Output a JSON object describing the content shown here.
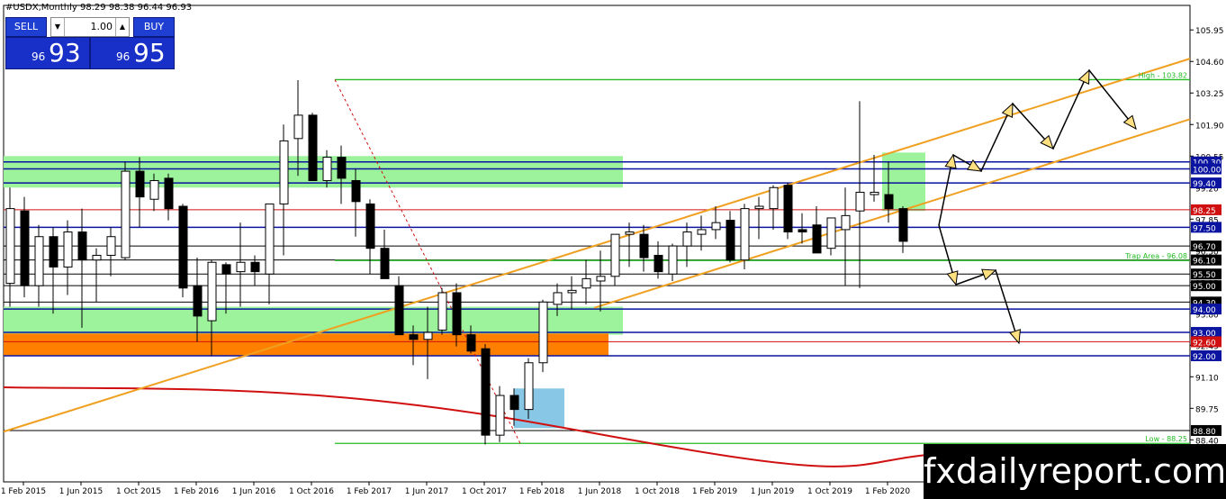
{
  "header": {
    "symbol": "#USDX,Monthly",
    "ohlc": "98.29 98.38 96.44 96.93"
  },
  "trade_panel": {
    "sell_label": "SELL",
    "buy_label": "BUY",
    "lot": "1.00",
    "sell_small": "96",
    "sell_big": "93",
    "buy_small": "96",
    "buy_big": "95"
  },
  "watermark": "fxdailyreport.com",
  "chart_data": {
    "type": "candlestick",
    "x_ticks": [
      "1 Feb 2015",
      "1 Jun 2015",
      "1 Oct 2015",
      "1 Feb 2016",
      "1 Jun 2016",
      "1 Oct 2016",
      "1 Feb 2017",
      "1 Jun 2017",
      "1 Oct 2017",
      "1 Feb 2018",
      "1 Jun 2018",
      "1 Oct 2018",
      "1 Feb 2019",
      "1 Jun 2019",
      "1 Oct 2019",
      "1 Feb 2020"
    ],
    "y_ticks": [
      "105.95",
      "104.60",
      "103.25",
      "101.90",
      "100.55",
      "99.20",
      "97.85",
      "96.50",
      "95.15",
      "93.80",
      "92.45",
      "91.10",
      "89.75",
      "88.40",
      "87.05"
    ],
    "y_range": [
      86.6,
      107.0
    ],
    "levels": [
      {
        "label": "100.30",
        "price": 100.3,
        "color": "#0a14a0"
      },
      {
        "label": "100.00",
        "price": 100.0,
        "color": "#0a14a0"
      },
      {
        "label": "99.40",
        "price": 99.4,
        "color": "#0a14a0"
      },
      {
        "label": "98.25",
        "price": 98.25,
        "color": "#d01010"
      },
      {
        "label": "97.50",
        "price": 97.5,
        "color": "#0a14a0"
      },
      {
        "label": "96.70",
        "price": 96.7,
        "color": "#000000"
      },
      {
        "label": "96.10",
        "price": 96.1,
        "color": "#000000"
      },
      {
        "label": "95.50",
        "price": 95.5,
        "color": "#000000"
      },
      {
        "label": "95.00",
        "price": 95.0,
        "color": "#000000"
      },
      {
        "label": "94.30",
        "price": 94.3,
        "color": "#000000"
      },
      {
        "label": "94.00",
        "price": 94.0,
        "color": "#0a14a0"
      },
      {
        "label": "93.00",
        "price": 93.0,
        "color": "#0a14a0"
      },
      {
        "label": "92.60",
        "price": 92.6,
        "color": "#d01010"
      },
      {
        "label": "92.00",
        "price": 92.0,
        "color": "#0a14a0"
      },
      {
        "label": "88.80",
        "price": 88.8,
        "color": "#000000"
      }
    ],
    "annotations": [
      {
        "label": "High - 103.82",
        "price": 103.82
      },
      {
        "label": "Trap Area - 96.08",
        "price": 96.08
      },
      {
        "label": "Low - 88.25",
        "price": 88.25
      }
    ],
    "candles": [
      {
        "o": 95.1,
        "h": 99.2,
        "l": 94.1,
        "c": 98.3
      },
      {
        "o": 98.2,
        "h": 98.8,
        "l": 94.5,
        "c": 95.0
      },
      {
        "o": 95.0,
        "h": 97.6,
        "l": 94.1,
        "c": 97.1
      },
      {
        "o": 97.1,
        "h": 97.5,
        "l": 93.8,
        "c": 95.8
      },
      {
        "o": 95.8,
        "h": 97.8,
        "l": 94.6,
        "c": 97.3
      },
      {
        "o": 97.3,
        "h": 98.3,
        "l": 93.2,
        "c": 96.1
      },
      {
        "o": 96.1,
        "h": 96.6,
        "l": 94.3,
        "c": 96.3
      },
      {
        "o": 96.3,
        "h": 97.5,
        "l": 95.4,
        "c": 97.1
      },
      {
        "o": 96.2,
        "h": 100.3,
        "l": 96.1,
        "c": 99.9
      },
      {
        "o": 99.9,
        "h": 100.5,
        "l": 97.5,
        "c": 98.8
      },
      {
        "o": 98.7,
        "h": 99.8,
        "l": 98.2,
        "c": 99.5
      },
      {
        "o": 99.6,
        "h": 99.8,
        "l": 97.8,
        "c": 98.3
      },
      {
        "o": 98.4,
        "h": 98.5,
        "l": 94.5,
        "c": 94.9
      },
      {
        "o": 95.0,
        "h": 96.2,
        "l": 92.6,
        "c": 93.7
      },
      {
        "o": 93.5,
        "h": 96.1,
        "l": 92.0,
        "c": 96.0
      },
      {
        "o": 95.9,
        "h": 96.0,
        "l": 93.8,
        "c": 95.5
      },
      {
        "o": 95.6,
        "h": 97.7,
        "l": 94.1,
        "c": 96.0
      },
      {
        "o": 96.0,
        "h": 96.3,
        "l": 95.0,
        "c": 95.6
      },
      {
        "o": 95.5,
        "h": 98.3,
        "l": 94.2,
        "c": 98.5
      },
      {
        "o": 98.5,
        "h": 101.9,
        "l": 96.3,
        "c": 101.2
      },
      {
        "o": 101.3,
        "h": 103.8,
        "l": 99.7,
        "c": 102.3
      },
      {
        "o": 102.3,
        "h": 102.4,
        "l": 99.5,
        "c": 99.5
      },
      {
        "o": 99.5,
        "h": 100.8,
        "l": 99.2,
        "c": 100.5
      },
      {
        "o": 100.5,
        "h": 101.0,
        "l": 98.5,
        "c": 99.6
      },
      {
        "o": 99.5,
        "h": 100.0,
        "l": 97.1,
        "c": 98.6
      },
      {
        "o": 98.5,
        "h": 98.7,
        "l": 95.5,
        "c": 96.6
      },
      {
        "o": 96.6,
        "h": 97.4,
        "l": 95.9,
        "c": 95.3
      },
      {
        "o": 95.0,
        "h": 95.4,
        "l": 93.2,
        "c": 92.9
      },
      {
        "o": 92.9,
        "h": 93.3,
        "l": 91.6,
        "c": 92.7
      },
      {
        "o": 92.7,
        "h": 94.1,
        "l": 91.0,
        "c": 93.0
      },
      {
        "o": 93.1,
        "h": 94.9,
        "l": 92.9,
        "c": 94.7
      },
      {
        "o": 94.7,
        "h": 95.1,
        "l": 92.4,
        "c": 92.9
      },
      {
        "o": 92.9,
        "h": 93.3,
        "l": 92.1,
        "c": 92.2
      },
      {
        "o": 92.3,
        "h": 92.5,
        "l": 88.2,
        "c": 88.6
      },
      {
        "o": 88.6,
        "h": 90.7,
        "l": 88.3,
        "c": 90.3
      },
      {
        "o": 90.3,
        "h": 90.6,
        "l": 89.0,
        "c": 89.7
      },
      {
        "o": 89.7,
        "h": 91.9,
        "l": 89.3,
        "c": 91.7
      },
      {
        "o": 91.7,
        "h": 94.4,
        "l": 91.3,
        "c": 94.3
      },
      {
        "o": 94.2,
        "h": 95.1,
        "l": 93.7,
        "c": 94.7
      },
      {
        "o": 94.7,
        "h": 95.4,
        "l": 94.0,
        "c": 94.8
      },
      {
        "o": 94.9,
        "h": 96.1,
        "l": 94.2,
        "c": 95.3
      },
      {
        "o": 95.2,
        "h": 96.5,
        "l": 93.9,
        "c": 95.4
      },
      {
        "o": 95.4,
        "h": 97.2,
        "l": 95.0,
        "c": 97.2
      },
      {
        "o": 97.2,
        "h": 97.7,
        "l": 95.8,
        "c": 97.3
      },
      {
        "o": 97.2,
        "h": 97.6,
        "l": 95.6,
        "c": 96.2
      },
      {
        "o": 96.3,
        "h": 96.9,
        "l": 95.3,
        "c": 95.6
      },
      {
        "o": 95.5,
        "h": 96.8,
        "l": 95.2,
        "c": 96.7
      },
      {
        "o": 96.7,
        "h": 97.7,
        "l": 95.8,
        "c": 97.3
      },
      {
        "o": 97.2,
        "h": 98.0,
        "l": 96.5,
        "c": 97.4
      },
      {
        "o": 97.4,
        "h": 98.4,
        "l": 97.0,
        "c": 97.7
      },
      {
        "o": 97.8,
        "h": 98.2,
        "l": 96.0,
        "c": 96.1
      },
      {
        "o": 96.1,
        "h": 98.5,
        "l": 95.7,
        "c": 98.3
      },
      {
        "o": 98.3,
        "h": 98.8,
        "l": 97.0,
        "c": 98.4
      },
      {
        "o": 98.3,
        "h": 99.3,
        "l": 97.4,
        "c": 99.2
      },
      {
        "o": 99.3,
        "h": 99.4,
        "l": 97.0,
        "c": 97.3
      },
      {
        "o": 97.4,
        "h": 98.1,
        "l": 96.8,
        "c": 97.3
      },
      {
        "o": 97.6,
        "h": 98.4,
        "l": 96.4,
        "c": 96.4
      },
      {
        "o": 96.6,
        "h": 97.9,
        "l": 96.3,
        "c": 97.9
      },
      {
        "o": 97.4,
        "h": 99.2,
        "l": 95.0,
        "c": 98.0
      },
      {
        "o": 98.2,
        "h": 102.9,
        "l": 94.9,
        "c": 99.0
      },
      {
        "o": 98.9,
        "h": 100.6,
        "l": 98.6,
        "c": 99.0
      },
      {
        "o": 98.9,
        "h": 100.3,
        "l": 97.7,
        "c": 98.3
      },
      {
        "o": 98.3,
        "h": 98.4,
        "l": 96.4,
        "c": 96.9
      }
    ]
  }
}
